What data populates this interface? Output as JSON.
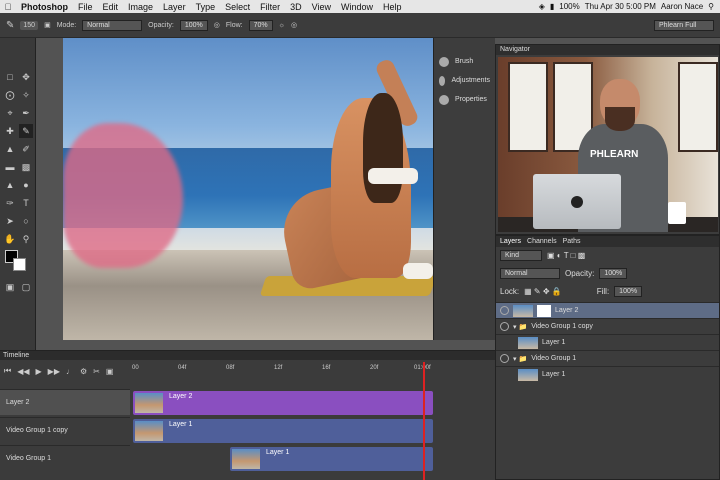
{
  "menubar": {
    "app": "Photoshop",
    "items": [
      "File",
      "Edit",
      "Image",
      "Layer",
      "Type",
      "Select",
      "Filter",
      "3D",
      "View",
      "Window",
      "Help"
    ],
    "battery": "100%",
    "clock": "Thu Apr 30  5:00 PM",
    "user": "Aaron Nace"
  },
  "options": {
    "brush_size": "150",
    "mode_label": "Mode:",
    "mode": "Normal",
    "opacity_label": "Opacity:",
    "opacity": "100%",
    "flow_label": "Flow:",
    "flow": "70%",
    "workspace": "Phlearn Full"
  },
  "mini_panel": {
    "items": [
      "Brush",
      "Adjustments",
      "Properties"
    ]
  },
  "navigator": {
    "title": "Navigator",
    "shirt_text": "PHLEARN"
  },
  "layers": {
    "tabs": [
      "Layers",
      "Channels",
      "Paths"
    ],
    "kind": "Kind",
    "blend": "Normal",
    "opacity_label": "Opacity:",
    "opacity": "100%",
    "lock_label": "Lock:",
    "fill_label": "Fill:",
    "fill": "100%",
    "rows": [
      "Layer 2",
      "Video Group 1 copy",
      "Layer 1",
      "Video Group 1",
      "Layer 1"
    ]
  },
  "timeline": {
    "title": "Timeline",
    "ruler": [
      "00",
      "04f",
      "08f",
      "12f",
      "16f",
      "20f",
      "01:00f"
    ],
    "tracks": [
      "Layer 2",
      "Video Group 1 copy",
      "Video Group 1"
    ],
    "clips": [
      "Layer 2",
      "Layer 1",
      "Layer 1"
    ]
  },
  "colors": {
    "purple_clip": "#8a4fc0",
    "blue_clip": "#4f5f9a",
    "playhead": "#dd2222"
  }
}
